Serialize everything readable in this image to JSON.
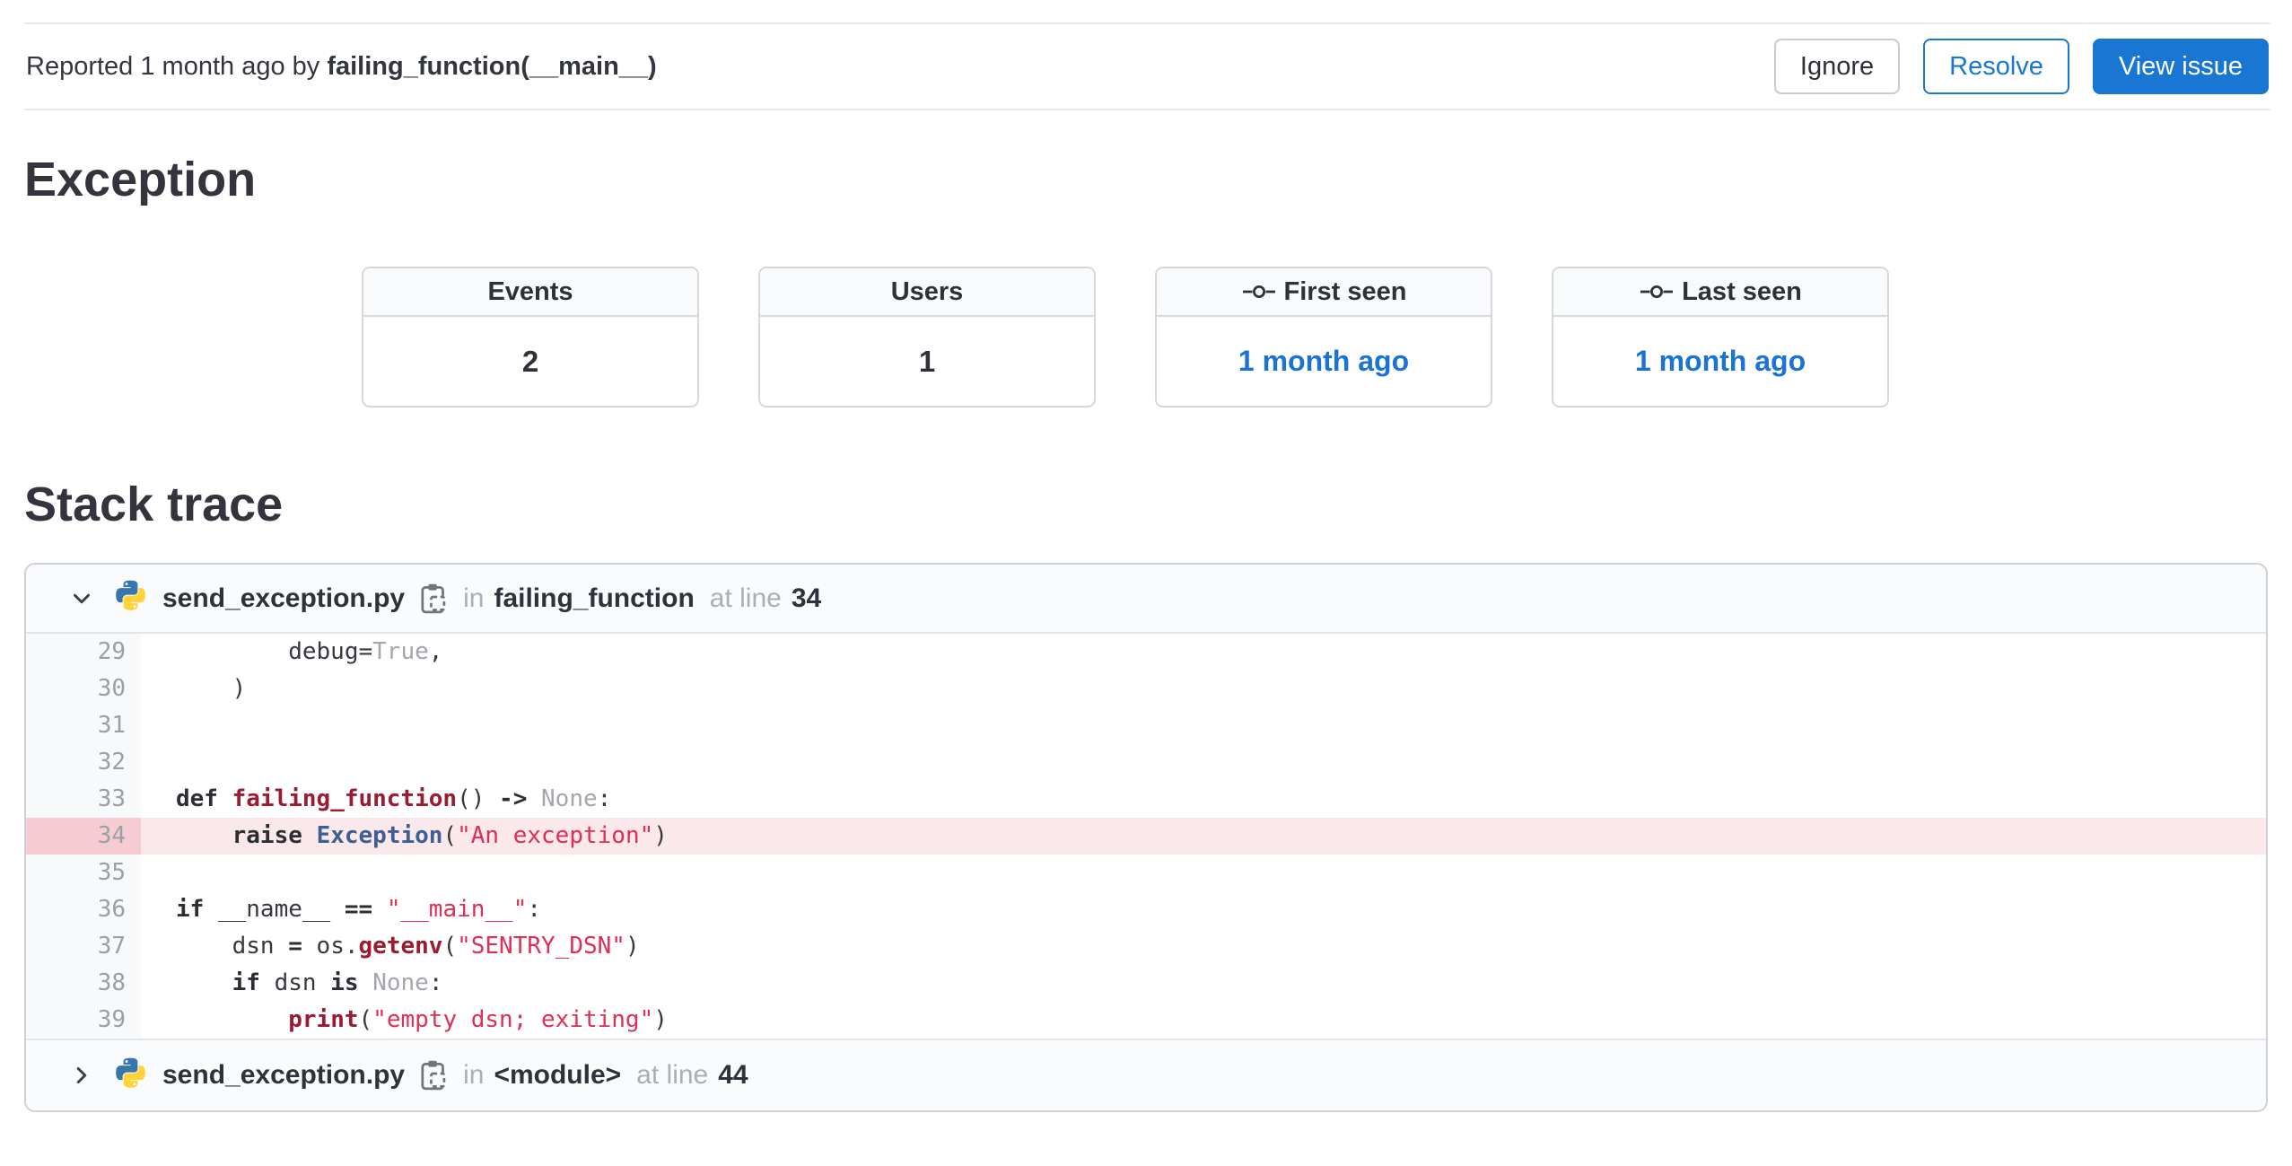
{
  "topbar": {
    "reported_prefix": "Reported 1 month ago by ",
    "reporter": "failing_function(__main__)",
    "buttons": {
      "ignore": "Ignore",
      "resolve": "Resolve",
      "view_issue": "View issue"
    }
  },
  "exception_section": {
    "title": "Exception"
  },
  "stats": {
    "cards": [
      {
        "label": "Events",
        "value": "2",
        "icon": null,
        "is_link": false
      },
      {
        "label": "Users",
        "value": "1",
        "icon": null,
        "is_link": false
      },
      {
        "label": "First seen",
        "value": "1 month ago",
        "icon": "commit-icon",
        "is_link": true
      },
      {
        "label": "Last seen",
        "value": "1 month ago",
        "icon": "commit-icon",
        "is_link": true
      }
    ]
  },
  "stack_trace": {
    "title": "Stack trace",
    "frames": [
      {
        "expanded": true,
        "file": "send_exception.py",
        "in_label": "in",
        "function": "failing_function",
        "at_label": "at line",
        "line": "34",
        "icons": [
          "chevron-down-icon",
          "python-icon",
          "copy-icon"
        ],
        "code": {
          "highlight_line": "34",
          "lines": [
            {
              "n": "29",
              "tokens": [
                [
                  "p",
                  "        debug="
                ],
                [
                  "c",
                  "True"
                ],
                [
                  "p",
                  ","
                ]
              ]
            },
            {
              "n": "30",
              "tokens": [
                [
                  "p",
                  "    )"
                ]
              ]
            },
            {
              "n": "31",
              "tokens": []
            },
            {
              "n": "32",
              "tokens": []
            },
            {
              "n": "33",
              "tokens": [
                [
                  "k",
                  "def"
                ],
                [
                  "p",
                  " "
                ],
                [
                  "f",
                  "failing_function"
                ],
                [
                  "p",
                  "() "
                ],
                [
                  "k",
                  "->"
                ],
                [
                  "p",
                  " "
                ],
                [
                  "c",
                  "None"
                ],
                [
                  "p",
                  ":"
                ]
              ]
            },
            {
              "n": "34",
              "tokens": [
                [
                  "p",
                  "    "
                ],
                [
                  "k",
                  "raise"
                ],
                [
                  "p",
                  " "
                ],
                [
                  "t",
                  "Exception"
                ],
                [
                  "p",
                  "("
                ],
                [
                  "s",
                  "\"An exception\""
                ],
                [
                  "p",
                  ")"
                ]
              ]
            },
            {
              "n": "35",
              "tokens": []
            },
            {
              "n": "36",
              "tokens": [
                [
                  "k",
                  "if"
                ],
                [
                  "p",
                  " __name__ "
                ],
                [
                  "k",
                  "=="
                ],
                [
                  "p",
                  " "
                ],
                [
                  "s",
                  "\"__main__\""
                ],
                [
                  "p",
                  ":"
                ]
              ]
            },
            {
              "n": "37",
              "tokens": [
                [
                  "p",
                  "    dsn "
                ],
                [
                  "k",
                  "="
                ],
                [
                  "p",
                  " os."
                ],
                [
                  "f",
                  "getenv"
                ],
                [
                  "p",
                  "("
                ],
                [
                  "s",
                  "\"SENTRY_DSN\""
                ],
                [
                  "p",
                  ")"
                ]
              ]
            },
            {
              "n": "38",
              "tokens": [
                [
                  "p",
                  "    "
                ],
                [
                  "k",
                  "if"
                ],
                [
                  "p",
                  " dsn "
                ],
                [
                  "k",
                  "is"
                ],
                [
                  "p",
                  " "
                ],
                [
                  "c",
                  "None"
                ],
                [
                  "p",
                  ":"
                ]
              ]
            },
            {
              "n": "39",
              "tokens": [
                [
                  "p",
                  "        "
                ],
                [
                  "f",
                  "print"
                ],
                [
                  "p",
                  "("
                ],
                [
                  "s",
                  "\"empty dsn; exiting\""
                ],
                [
                  "p",
                  ")"
                ]
              ]
            }
          ]
        }
      },
      {
        "expanded": false,
        "file": "send_exception.py",
        "in_label": "in",
        "function": "<module>",
        "at_label": "at line",
        "line": "44",
        "icons": [
          "chevron-right-icon",
          "python-icon",
          "copy-icon"
        ]
      }
    ]
  },
  "colors": {
    "accent_blue": "#1976d2",
    "link_blue": "#1b74d3",
    "highlight_row_bg": "#fbe8ea",
    "highlight_gutter_bg": "#f6ccd2",
    "string_red": "#e02e56",
    "function_red": "#9b1b30",
    "class_blue": "#3e5f94",
    "python_blue": "#3776ab",
    "python_yellow": "#ffd43b"
  }
}
